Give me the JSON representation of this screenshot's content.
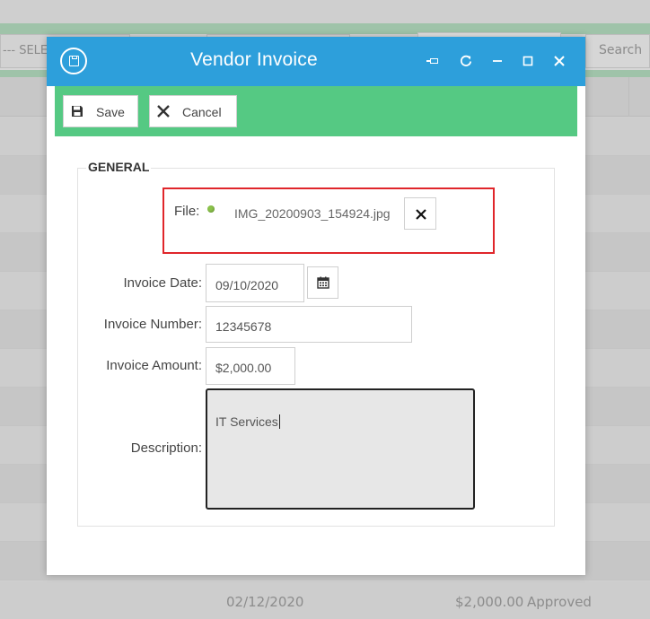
{
  "background": {
    "select_placeholder": "--- SELE",
    "search_label": "Search",
    "last_row": {
      "date": "02/12/2020",
      "amount": "$2,000.00",
      "status": "Approved"
    }
  },
  "modal": {
    "title": "Vendor Invoice",
    "titlebar_icons": [
      "document-icon",
      "pin-icon",
      "refresh-icon",
      "minimize-icon",
      "maximize-icon",
      "close-icon"
    ],
    "colors": {
      "titlebar": "#2d9fdb",
      "actionbar": "#55c983",
      "highlight_border": "#e0262b"
    }
  },
  "actions": {
    "save_label": "Save",
    "cancel_label": "Cancel"
  },
  "form": {
    "section_title": "GENERAL",
    "file": {
      "label": "File:",
      "filename": "IMG_20200903_154924.jpg"
    },
    "invoice_date": {
      "label": "Invoice Date:",
      "value": "09/10/2020"
    },
    "invoice_number": {
      "label": "Invoice Number:",
      "value": "12345678"
    },
    "invoice_amount": {
      "label": "Invoice Amount:",
      "value": "$2,000.00"
    },
    "description": {
      "label": "Description:",
      "value": "IT Services"
    }
  }
}
